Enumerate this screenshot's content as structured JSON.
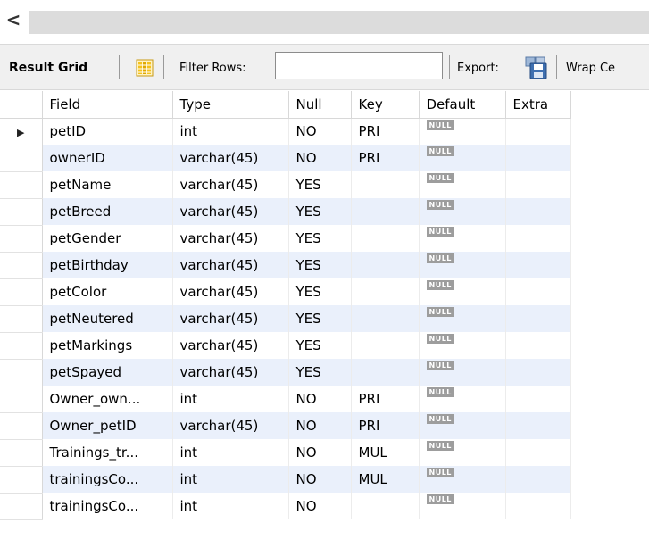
{
  "topbar": {
    "scroll_left_icon": "chevron-left-icon",
    "scroll_left_glyph": "<"
  },
  "toolbar": {
    "result_grid_label": "Result Grid",
    "grid_icon": "grid-layout-icon",
    "filter_label": "Filter Rows:",
    "filter_value": "",
    "export_label": "Export:",
    "export_icon": "export-save-icon",
    "wrap_label": "Wrap Ce"
  },
  "grid": {
    "columns": [
      "Field",
      "Type",
      "Null",
      "Key",
      "Default",
      "Extra"
    ],
    "null_badge": "NULL",
    "current_row_icon": "row-pointer-icon",
    "current_row_glyph": "▶",
    "rows": [
      {
        "field": "petID",
        "type": "int",
        "null": "NO",
        "key": "PRI",
        "default": "NULL",
        "extra": ""
      },
      {
        "field": "ownerID",
        "type": "varchar(45)",
        "null": "NO",
        "key": "PRI",
        "default": "NULL",
        "extra": ""
      },
      {
        "field": "petName",
        "type": "varchar(45)",
        "null": "YES",
        "key": "",
        "default": "NULL",
        "extra": ""
      },
      {
        "field": "petBreed",
        "type": "varchar(45)",
        "null": "YES",
        "key": "",
        "default": "NULL",
        "extra": ""
      },
      {
        "field": "petGender",
        "type": "varchar(45)",
        "null": "YES",
        "key": "",
        "default": "NULL",
        "extra": ""
      },
      {
        "field": "petBirthday",
        "type": "varchar(45)",
        "null": "YES",
        "key": "",
        "default": "NULL",
        "extra": ""
      },
      {
        "field": "petColor",
        "type": "varchar(45)",
        "null": "YES",
        "key": "",
        "default": "NULL",
        "extra": ""
      },
      {
        "field": "petNeutered",
        "type": "varchar(45)",
        "null": "YES",
        "key": "",
        "default": "NULL",
        "extra": ""
      },
      {
        "field": "petMarkings",
        "type": "varchar(45)",
        "null": "YES",
        "key": "",
        "default": "NULL",
        "extra": ""
      },
      {
        "field": "petSpayed",
        "type": "varchar(45)",
        "null": "YES",
        "key": "",
        "default": "NULL",
        "extra": ""
      },
      {
        "field": "Owner_own...",
        "type": "int",
        "null": "NO",
        "key": "PRI",
        "default": "NULL",
        "extra": ""
      },
      {
        "field": "Owner_petID",
        "type": "varchar(45)",
        "null": "NO",
        "key": "PRI",
        "default": "NULL",
        "extra": ""
      },
      {
        "field": "Trainings_tr...",
        "type": "int",
        "null": "NO",
        "key": "MUL",
        "default": "NULL",
        "extra": ""
      },
      {
        "field": "trainingsCo...",
        "type": "int",
        "null": "NO",
        "key": "MUL",
        "default": "NULL",
        "extra": ""
      },
      {
        "field": "trainingsCo...",
        "type": "int",
        "null": "NO",
        "key": "",
        "default": "NULL",
        "extra": ""
      }
    ]
  }
}
